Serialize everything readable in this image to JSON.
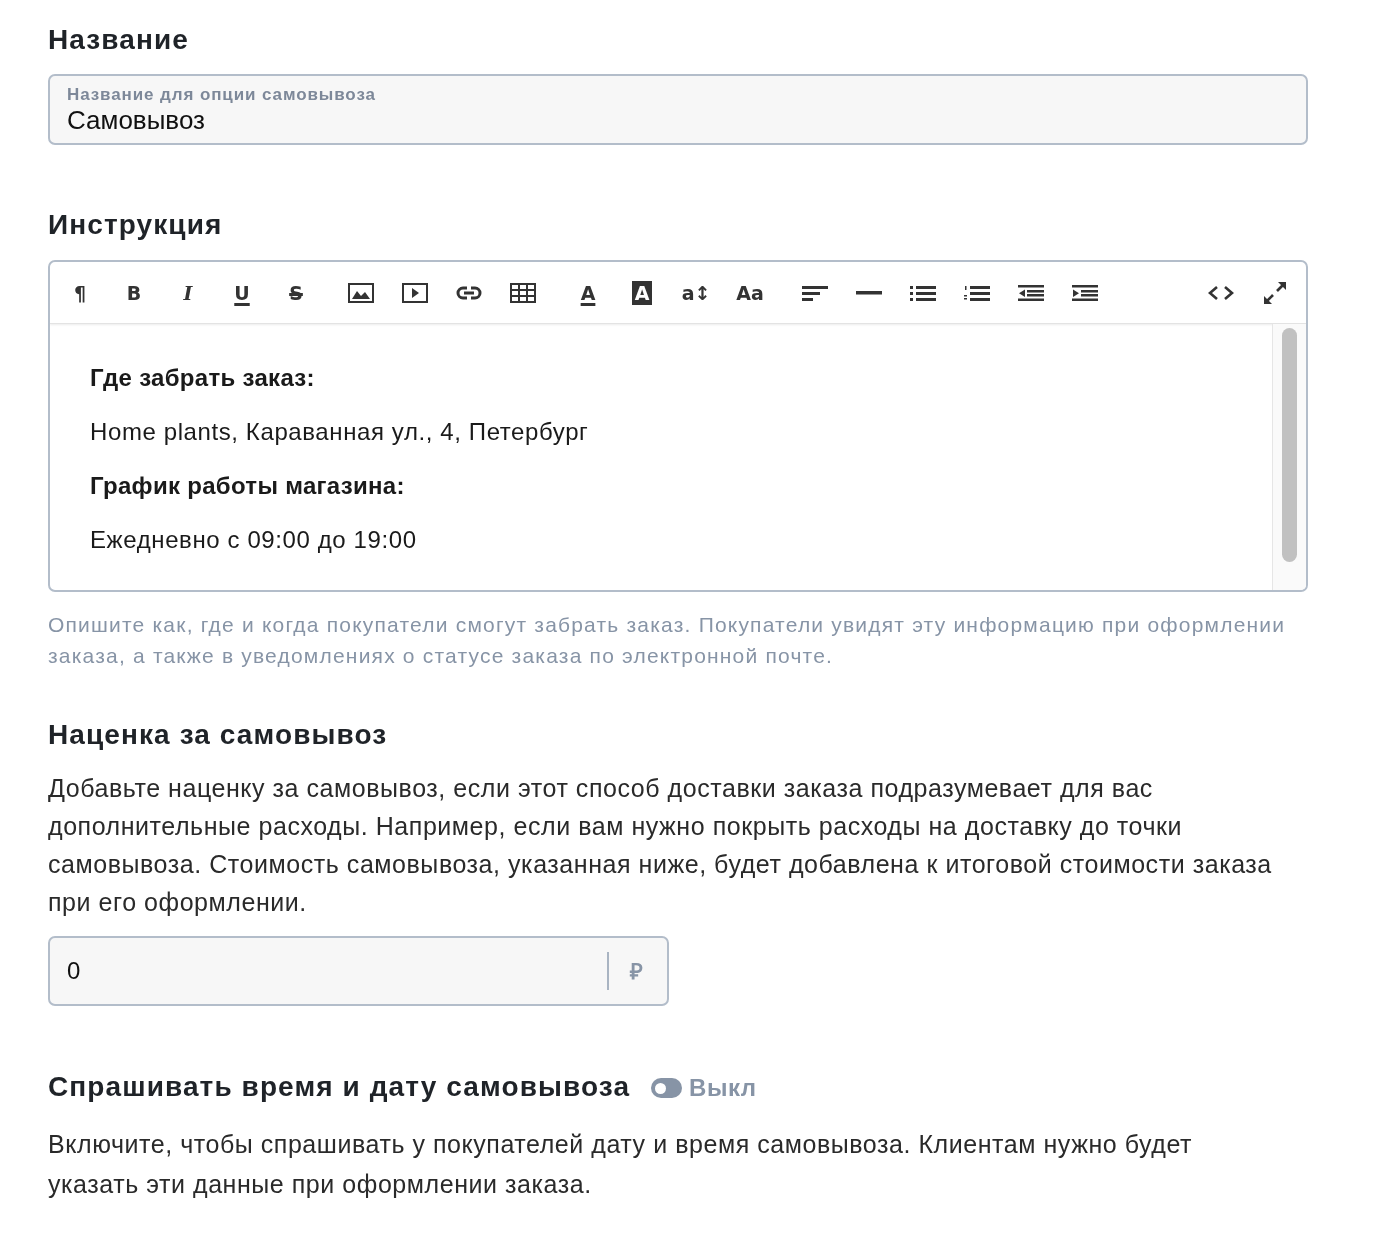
{
  "name_section": {
    "heading": "Название",
    "field": {
      "label": "Название для опции самовывоза",
      "value": "Самовывоз"
    }
  },
  "instruction_section": {
    "heading": "Инструкция",
    "toolbar": [
      [
        {
          "kind": "bold",
          "label": "¶"
        },
        {
          "kind": "bold",
          "label": "B"
        },
        {
          "kind": "italic",
          "label": "I"
        },
        {
          "kind": "underline",
          "label": "U"
        },
        {
          "kind": "strike",
          "label": "S"
        }
      ],
      [
        {
          "kind": "icon"
        },
        {
          "kind": "icon"
        },
        {
          "kind": "icon"
        },
        {
          "kind": "icon"
        }
      ],
      [
        {
          "kind": "underline",
          "label": "A"
        },
        {
          "kind": "inverse",
          "label": "A"
        },
        {
          "kind": "bold",
          "label": "a↕"
        },
        {
          "kind": "bold",
          "label": "Aa"
        }
      ],
      [
        {
          "kind": "icon"
        },
        {
          "kind": "icon"
        },
        {
          "kind": "icon"
        },
        {
          "kind": "icon"
        },
        {
          "kind": "icon"
        },
        {
          "kind": "icon"
        }
      ],
      [
        {
          "kind": "icon"
        },
        {
          "kind": "icon"
        }
      ]
    ],
    "content": [
      {
        "kind": "heading",
        "text": "Где забрать заказ:"
      },
      {
        "kind": "paragraph",
        "text": "Home plants, Караванная ул., 4, Петербург"
      },
      {
        "kind": "heading",
        "text": "График работы магазина:"
      },
      {
        "kind": "paragraph",
        "text": "Ежедневно с 09:00 до 19:00"
      }
    ],
    "help": "Опишите как, где и когда покупатели смогут забрать заказ. Покупатели увидят эту информацию при оформлении заказа, а также в уведомлениях о статусе заказа по электронной почте."
  },
  "markup_section": {
    "heading": "Наценка за самовывоз",
    "description": "Добавьте наценку за самовывоз, если этот способ доставки заказа подразумевает для вас дополнительные расходы. Например, если вам нужно покрыть расходы на доставку до точки самовывоза. Стоимость самовывоза, указанная ниже, будет добавлена к итоговой стоимости заказа при его оформлении.",
    "price_field": {
      "value": "0",
      "currency": "₽"
    }
  },
  "pickup_time_section": {
    "heading": "Спрашивать время и дату самовывоза",
    "toggle": {
      "on": false,
      "label": "Выкл"
    },
    "description": "Включите, чтобы спрашивать у покупателей дату и время самовывоза. Клиентам нужно будет указать эти данные при оформлении заказа."
  }
}
